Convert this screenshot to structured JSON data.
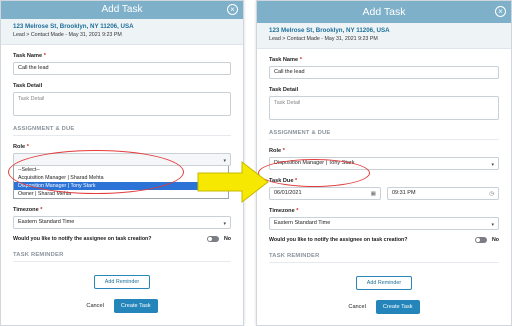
{
  "left": {
    "title": "Add Task",
    "address": "123 Melrose St, Brooklyn, NY 11206, USA",
    "meta": "Lead > Contact Made - May 31, 2021 9:23 PM",
    "task_name_label": "Task Name",
    "task_name_value": "Call the lead",
    "task_detail_label": "Task Detail",
    "task_detail_placeholder": "Task Detail",
    "section_assignment": "ASSIGNMENT & DUE",
    "role_label": "Role",
    "role_options": [
      "--Select--",
      "Acquisition Manager | Sharad Mehta",
      "Disposition Manager | Tony Stark",
      "Owner | Sharad Mehta"
    ],
    "timezone_label": "Timezone",
    "timezone_value": "Eastern Standard Time",
    "notify_question": "Would you like to notify the assignee on task creation?",
    "notify_value": "No",
    "section_reminder": "TASK REMINDER",
    "add_reminder": "Add Reminder",
    "cancel": "Cancel",
    "create": "Create Task"
  },
  "right": {
    "title": "Add Task",
    "address": "123 Melrose St, Brooklyn, NY 11206, USA",
    "meta": "Lead > Contact Made - May 31, 2021 9:23 PM",
    "task_name_label": "Task Name",
    "task_name_value": "Call the lead",
    "task_detail_label": "Task Detail",
    "task_detail_placeholder": "Task Detail",
    "section_assignment": "ASSIGNMENT & DUE",
    "role_label": "Role",
    "role_value": "Disposition Manager | Tony Stark",
    "task_due_label": "Task Due",
    "due_date": "06/01/2021",
    "due_time": "09:31 PM",
    "timezone_label": "Timezone",
    "timezone_value": "Eastern Standard Time",
    "notify_question": "Would you like to notify the assignee on task creation?",
    "notify_value": "No",
    "section_reminder": "TASK REMINDER",
    "add_reminder": "Add Reminder",
    "cancel": "Cancel",
    "create": "Create Task"
  },
  "colors": {
    "header": "#7fb0c9",
    "primary": "#2385b9",
    "annotation_red": "#e23b3b",
    "arrow_yellow": "#f6e800"
  }
}
